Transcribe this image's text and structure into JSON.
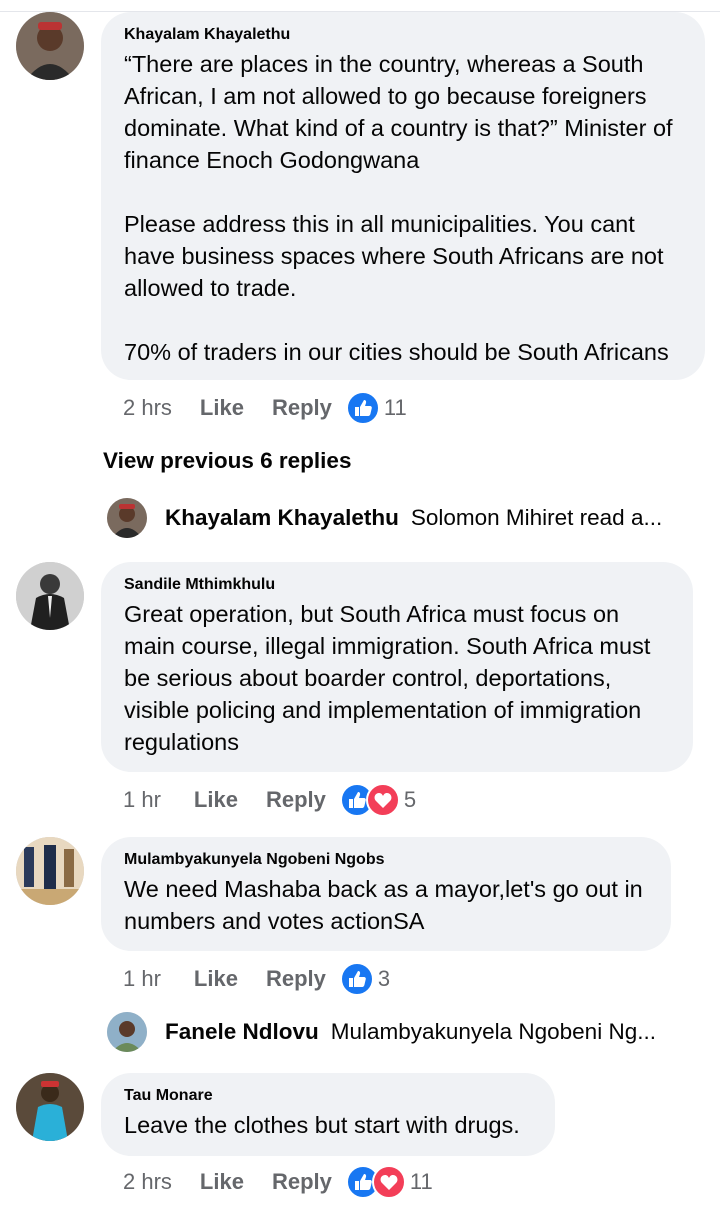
{
  "comments": [
    {
      "author": "Khayalam Khayalethu",
      "text": "“There are places in the country, whereas a South African, I am not allowed to go because foreigners dominate. What kind of a country is that?” Minister of finance Enoch Godongwana\n\nPlease address this in all municipalities. You cant have business spaces where South Africans are not allowed to trade.\n\n70% of traders in our cities should be South Africans",
      "time": "2 hrs",
      "like": "Like",
      "reply": "Reply",
      "reaction_count": "11"
    },
    {
      "author": "Sandile Mthimkhulu",
      "text": "Great operation, but South Africa must focus on main course, illegal immigration. South Africa must be serious about boarder control, deportations, visible policing and implementation of immigration regulations",
      "time": "1 hr",
      "like": "Like",
      "reply": "Reply",
      "reaction_count": "5"
    },
    {
      "author": "Mulambyakunyela Ngobeni Ngobs",
      "text": "We need Mashaba back as a mayor,let's go out in numbers and votes actionSA",
      "time": "1 hr",
      "like": "Like",
      "reply": "Reply",
      "reaction_count": "3"
    },
    {
      "author": "Tau Monare",
      "text": "Leave the clothes but start with drugs.",
      "time": "2 hrs",
      "like": "Like",
      "reply": "Reply",
      "reaction_count": "11"
    }
  ],
  "view_previous": "View previous 6 replies",
  "replies": [
    {
      "author": "Khayalam Khayalethu",
      "preview": "Solomon Mihiret read a..."
    },
    {
      "author": "Fanele Ndlovu",
      "preview": "Mulambyakunyela Ngobeni Ng..."
    }
  ],
  "colors": {
    "bubble": "#f0f2f5",
    "meta": "#65676b",
    "like_blue": "#1877f2",
    "love_red": "#f33e58"
  }
}
